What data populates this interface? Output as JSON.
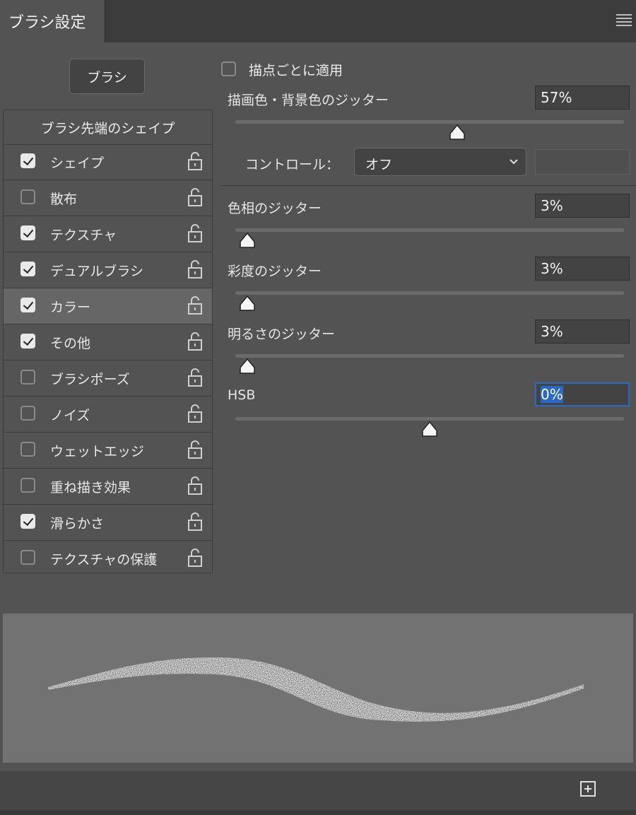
{
  "panel": {
    "title": "ブラシ設定",
    "menu_icon": "hamburger-menu-icon"
  },
  "brush_button": {
    "label": "ブラシ"
  },
  "brush_list": {
    "header": "ブラシ先端のシェイプ",
    "items": [
      {
        "label": "シェイプ",
        "checked": true
      },
      {
        "label": "散布",
        "checked": false
      },
      {
        "label": "テクスチャ",
        "checked": true
      },
      {
        "label": "デュアルブラシ",
        "checked": true
      },
      {
        "label": "カラー",
        "checked": true,
        "selected": true
      },
      {
        "label": "その他",
        "checked": true
      },
      {
        "label": "ブラシポーズ",
        "checked": false
      },
      {
        "label": "ノイズ",
        "checked": false
      },
      {
        "label": "ウェットエッジ",
        "checked": false
      },
      {
        "label": "重ね描き効果",
        "checked": false
      },
      {
        "label": "滑らかさ",
        "checked": true
      },
      {
        "label": "テクスチャの保護",
        "checked": false
      }
    ]
  },
  "color_settings": {
    "apply_per_tip": {
      "label": "描点ごとに適用",
      "checked": false
    },
    "fg_bg_jitter": {
      "label": "描画色・背景色のジッター",
      "value": "57%",
      "slider": 0.57
    },
    "control": {
      "label": "コントロール：",
      "selected": "オフ"
    },
    "hue_jitter": {
      "label": "色相のジッター",
      "value": "3%",
      "slider": 0.03
    },
    "saturation_jitter": {
      "label": "彩度のジッター",
      "value": "3%",
      "slider": 0.03
    },
    "brightness_jitter": {
      "label": "明るさのジッター",
      "value": "3%",
      "slider": 0.03
    },
    "purity": {
      "label": "HSB",
      "value": "0%",
      "slider": 0.5
    }
  },
  "colors": {
    "panel_bg": "#535353",
    "selected_row": "#666666",
    "focus_blue": "#2a68c2"
  }
}
